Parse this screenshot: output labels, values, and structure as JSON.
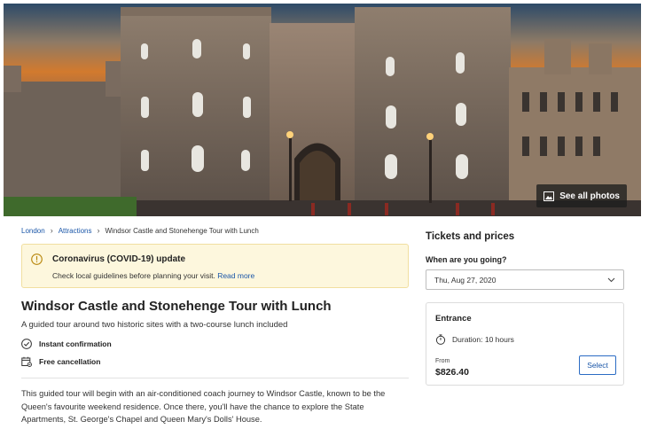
{
  "hero": {
    "see_all_label": "See all photos",
    "icon": "gallery-icon"
  },
  "breadcrumb": {
    "items": [
      "London",
      "Attractions",
      "Windsor Castle and Stonehenge Tour with Lunch"
    ]
  },
  "notice": {
    "title": "Coronavirus (COVID-19) update",
    "text": "Check local guidelines before planning your visit.",
    "link": "Read more",
    "icon": "info-icon"
  },
  "tour": {
    "title": "Windsor Castle and Stonehenge Tour with Lunch",
    "subtitle": "A guided tour around two historic sites with a two-course lunch included",
    "features": [
      {
        "icon": "check-circle-icon",
        "label": "Instant confirmation"
      },
      {
        "icon": "calendar-cancel-icon",
        "label": "Free cancellation"
      }
    ],
    "description_lines": [
      "This guided tour will begin with an air-conditioned coach journey to Windsor Castle, known to be the",
      "Queen's favourite weekend residence. Once there, you'll have the chance to explore the State",
      "Apartments, St. George's Chapel and Queen Mary's Dolls' House."
    ]
  },
  "booking": {
    "title": "Tickets and prices",
    "when_label": "When are you going?",
    "date_value": "Thu, Aug 27, 2020",
    "ticket": {
      "title": "Entrance",
      "duration": "Duration: 10 hours",
      "from_label": "From",
      "price": "$826.40",
      "select_label": "Select"
    }
  },
  "colors": {
    "link": "#1a56a8",
    "notice_bg": "#fdf7dd",
    "button_border": "#2b6cc4"
  }
}
